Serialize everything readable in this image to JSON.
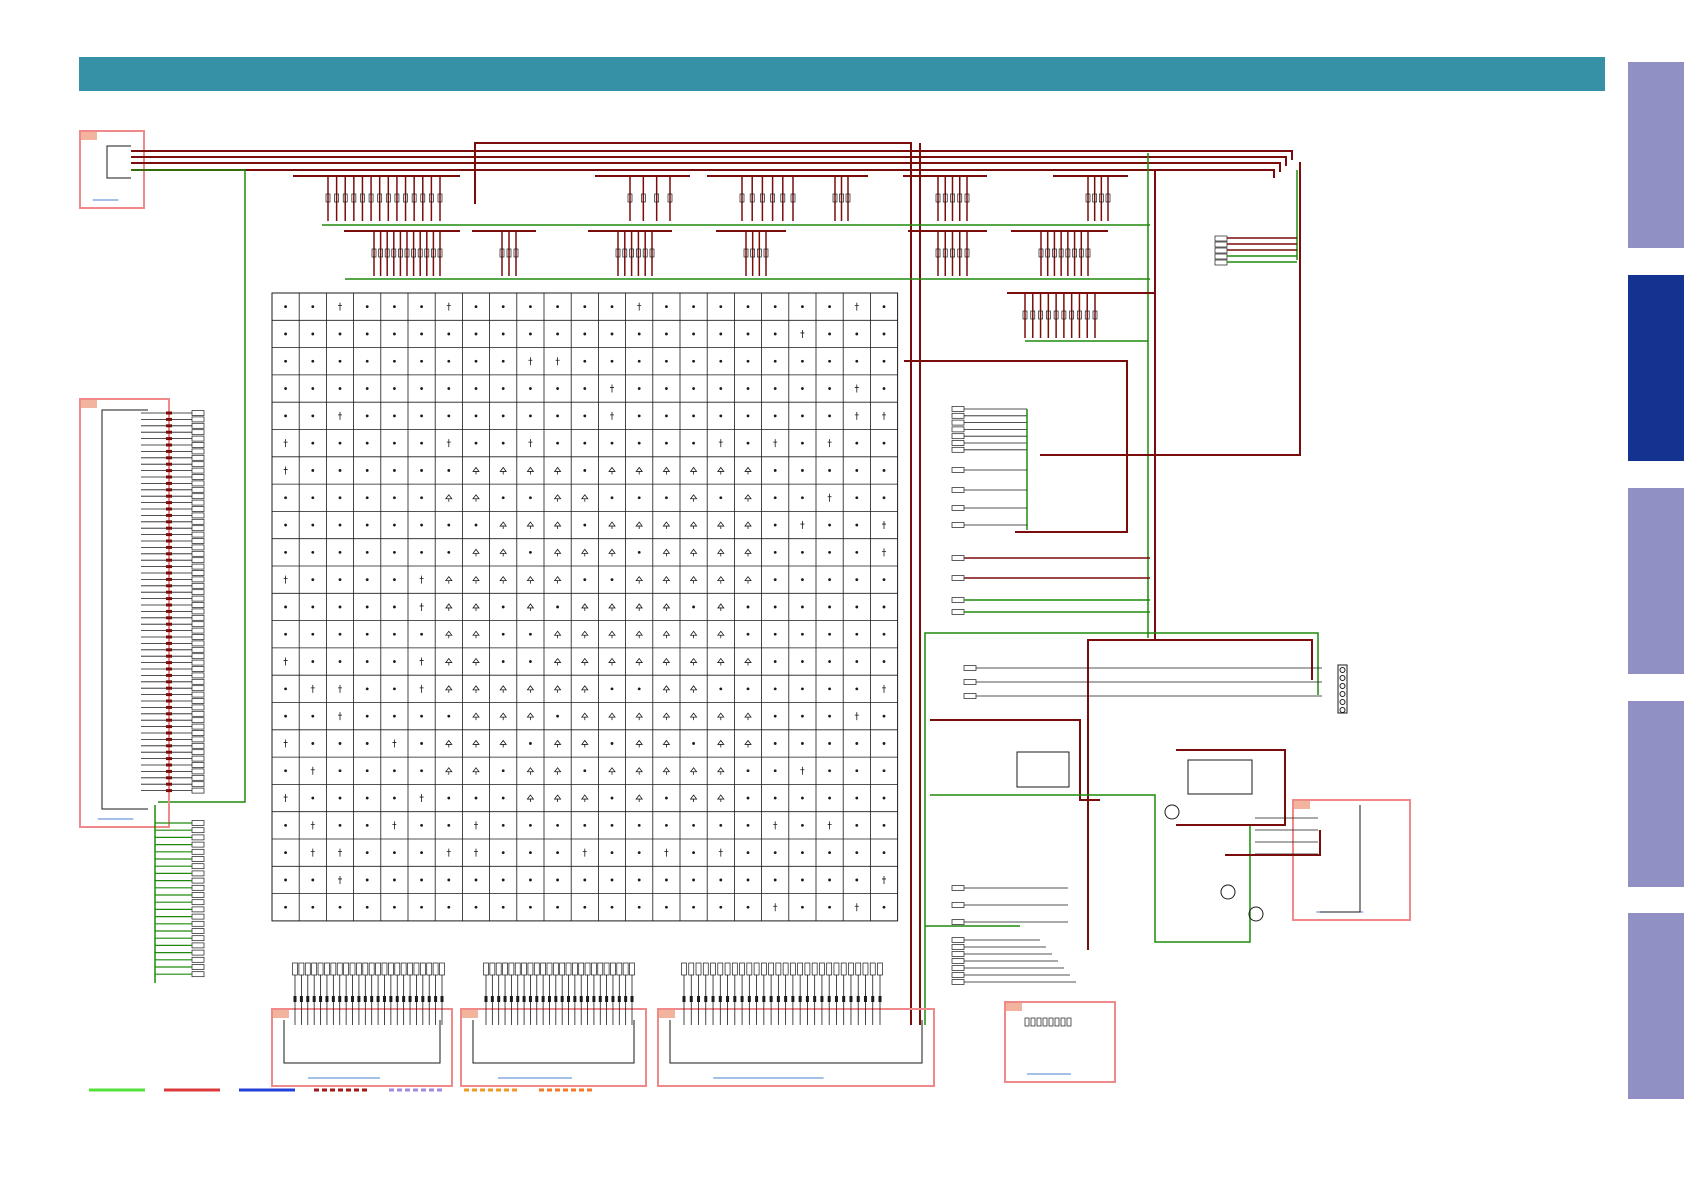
{
  "colors": {
    "header": "#3791a6",
    "tab_inactive": "#9090c4",
    "tab_active": "#143391",
    "wire_green": "#1d8a0a",
    "wire_red": "#7b0c0c",
    "wire_black": "#1a1a1a",
    "connector_box": "#f08a8a",
    "connector_tag": "#f2b49c",
    "link_blue": "#4a7fd0"
  },
  "side_tabs": [
    {
      "name": "tab-1",
      "active": false
    },
    {
      "name": "tab-2",
      "active": true
    },
    {
      "name": "tab-3",
      "active": false
    },
    {
      "name": "tab-4",
      "active": false
    },
    {
      "name": "tab-5",
      "active": false
    }
  ],
  "legend": [
    {
      "color": "#53e23c",
      "style": "solid"
    },
    {
      "color": "#dc3a3a",
      "style": "solid"
    },
    {
      "color": "#2540d8",
      "style": "solid"
    },
    {
      "color": "#a01a1a",
      "style": "dashed"
    },
    {
      "color": "#a58ae0",
      "style": "dashed"
    },
    {
      "color": "#f0982a",
      "style": "dashed"
    },
    {
      "color": "#f07a2a",
      "style": "dashed"
    }
  ],
  "icons": {
    "node": "junction-dot",
    "diode": "led-diode-icon",
    "transistor": "transistor-icon"
  }
}
